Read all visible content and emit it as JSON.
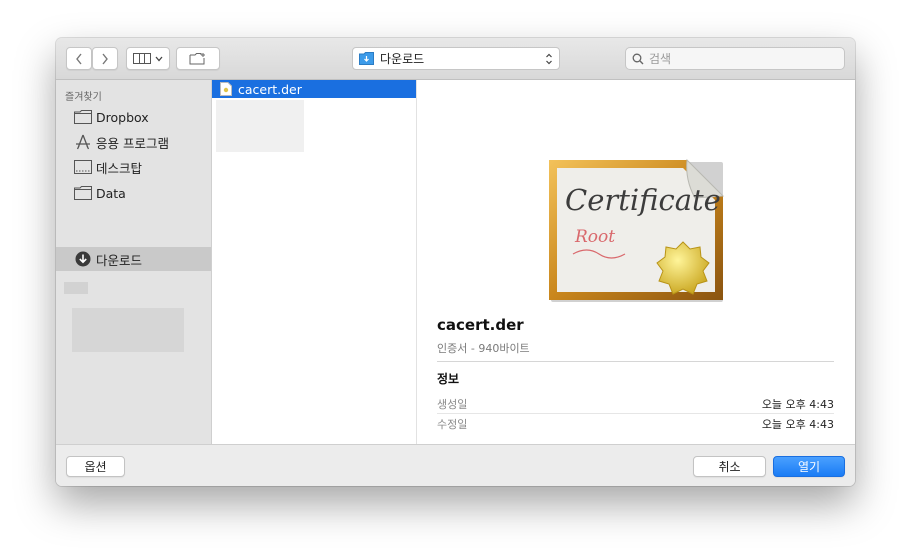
{
  "toolbar": {
    "path_label": "다운로드",
    "search_placeholder": "검색"
  },
  "sidebar": {
    "section_title": "즐겨찾기",
    "items": [
      {
        "label": "Dropbox",
        "icon": "folder-icon"
      },
      {
        "label": "응용 프로그램",
        "icon": "applications-icon"
      },
      {
        "label": "데스크탑",
        "icon": "desktop-icon"
      },
      {
        "label": "Data",
        "icon": "folder-icon"
      },
      {
        "label": "다운로드",
        "icon": "download-icon",
        "selected": true
      }
    ]
  },
  "file_list": {
    "items": [
      {
        "name": "cacert.der",
        "selected": true
      }
    ]
  },
  "preview": {
    "image_text_line1": "Certificate",
    "image_text_line2": "Root",
    "file_name": "cacert.der",
    "kind": "인증서 - 940바이트",
    "info_title": "정보",
    "rows": [
      {
        "label": "생성일",
        "value": "오늘 오후 4:43"
      },
      {
        "label": "수정일",
        "value": "오늘 오후 4:43"
      }
    ]
  },
  "buttons": {
    "options": "옵션",
    "cancel": "취소",
    "open": "열기"
  },
  "colors": {
    "accent": "#1a6fe0",
    "sidebar_bg": "#e3e3e3",
    "window_bg": "#ececec"
  }
}
